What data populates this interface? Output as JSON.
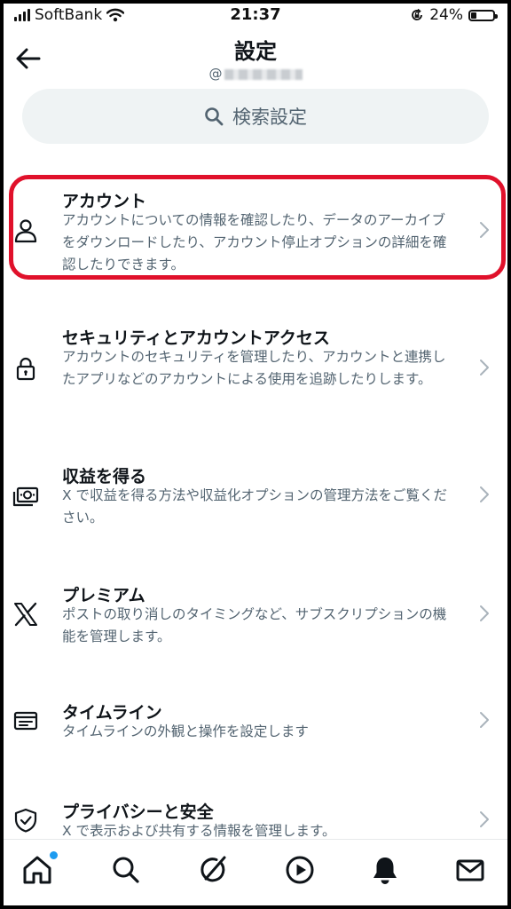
{
  "status_bar": {
    "carrier": "SoftBank",
    "time": "21:37",
    "battery_percent": "24%",
    "battery_level": 0.24
  },
  "header": {
    "title": "設定",
    "handle_prefix": "@"
  },
  "search": {
    "label": "検索設定"
  },
  "settings_items": [
    {
      "icon": "person-icon",
      "title": "アカウント",
      "description": "アカウントについての情報を確認したり、データのアーカイブをダウンロードしたり、アカウント停止オプションの詳細を確認したりできます。"
    },
    {
      "icon": "lock-icon",
      "title": "セキュリティとアカウントアクセス",
      "description": "アカウントのセキュリティを管理したり、アカウントと連携したアプリなどのアカウントによる使用を追跡したりします。"
    },
    {
      "icon": "money-icon",
      "title": "収益を得る",
      "description": "X で収益を得る方法や収益化オプションの管理方法をご覧ください。"
    },
    {
      "icon": "x-logo-icon",
      "title": "プレミアム",
      "description": "ポストの取り消しのタイミングなど、サブスクリプションの機能を管理します。"
    },
    {
      "icon": "timeline-icon",
      "title": "タイムライン",
      "description": "タイムラインの外観と操作を設定します"
    },
    {
      "icon": "shield-icon",
      "title": "プライバシーと安全",
      "description": "X で表示および共有する情報を管理します。"
    }
  ],
  "bottom_nav": [
    {
      "icon": "home-icon",
      "has_notification_dot": true
    },
    {
      "icon": "search-icon"
    },
    {
      "icon": "grok-icon"
    },
    {
      "icon": "play-icon"
    },
    {
      "icon": "bell-icon"
    },
    {
      "icon": "mail-icon"
    }
  ],
  "colors": {
    "highlight": "#e0112b",
    "text_primary": "#0f1419",
    "text_secondary": "#536471",
    "search_bg": "#eff3f4",
    "notification_dot": "#1d9bf0"
  }
}
